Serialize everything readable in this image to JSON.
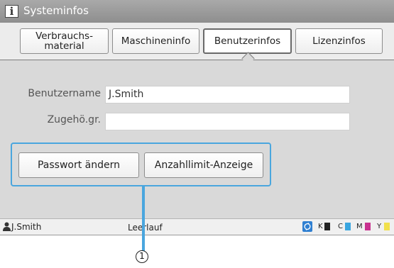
{
  "window": {
    "title": "Systeminfos",
    "icon": "info-icon"
  },
  "tabs": [
    {
      "label": "Verbrauchs-\nmaterial",
      "active": false
    },
    {
      "label": "Maschineninfo",
      "active": false
    },
    {
      "label": "Benutzerinfos",
      "active": true
    },
    {
      "label": "Lizenzinfos",
      "active": false
    }
  ],
  "fields": {
    "username": {
      "label": "Benutzername",
      "value": "J.Smith"
    },
    "group": {
      "label": "Zugehö.gr.",
      "value": ""
    }
  },
  "buttons": {
    "change_password": "Passwort ändern",
    "limit_display": "Anzahllimit-Anzeige"
  },
  "status": {
    "user": "J.Smith",
    "state": "Leerlauf",
    "inks": [
      {
        "letter": "K",
        "color": "#222222"
      },
      {
        "letter": "C",
        "color": "#3aa6e0"
      },
      {
        "letter": "M",
        "color": "#c8318f"
      },
      {
        "letter": "Y",
        "color": "#f1e04c"
      }
    ]
  },
  "callout": {
    "number": "1"
  },
  "colors": {
    "accent": "#4aa6de"
  }
}
